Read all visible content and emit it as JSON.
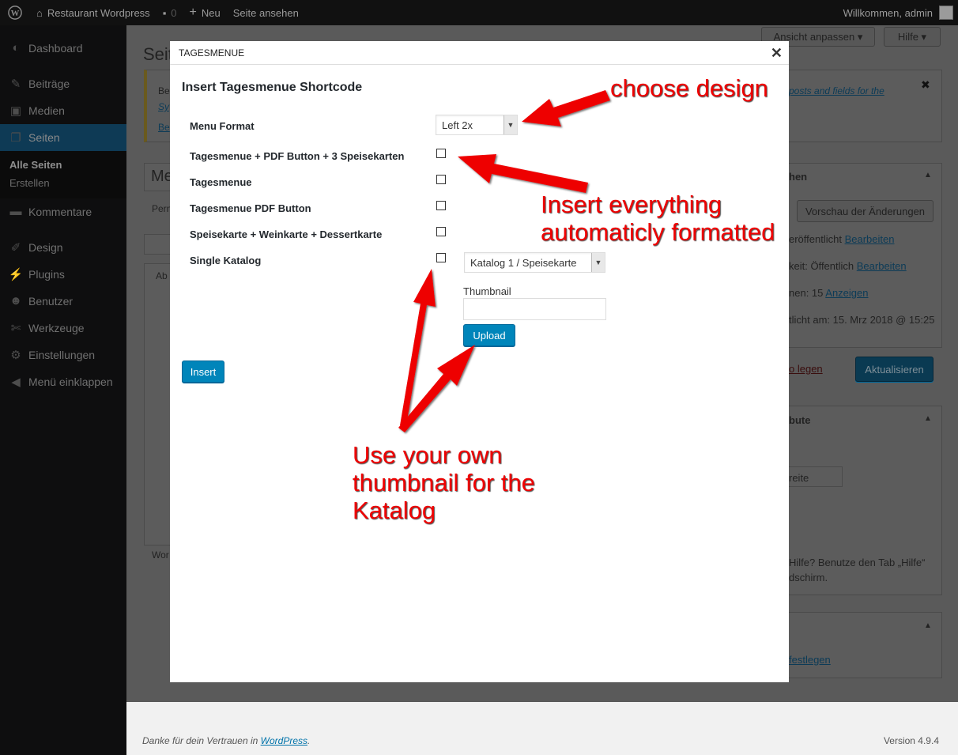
{
  "adminbar": {
    "site_name": "Restaurant Wordpress",
    "comments_count": "0",
    "new_label": "Neu",
    "view_page": "Seite ansehen",
    "welcome": "Willkommen, admin"
  },
  "sidebar": {
    "items": [
      {
        "label": "Dashboard",
        "icon": "dashboard-icon"
      },
      {
        "label": "Beiträge",
        "icon": "pin-icon"
      },
      {
        "label": "Medien",
        "icon": "media-icon"
      },
      {
        "label": "Seiten",
        "icon": "pages-icon"
      },
      {
        "label": "Kommentare",
        "icon": "comment-icon"
      },
      {
        "label": "Design",
        "icon": "brush-icon"
      },
      {
        "label": "Plugins",
        "icon": "plugin-icon"
      },
      {
        "label": "Benutzer",
        "icon": "user-icon"
      },
      {
        "label": "Werkzeuge",
        "icon": "wrench-icon"
      },
      {
        "label": "Einstellungen",
        "icon": "settings-icon"
      },
      {
        "label": "Menü einklappen",
        "icon": "collapse-icon"
      }
    ],
    "submenu": [
      "Alle Seiten",
      "Erstellen"
    ]
  },
  "background": {
    "screen_options": "Ansicht anpassen",
    "help": "Hilfe",
    "page_heading": "Seit",
    "notice_b1": "Be",
    "notice_b2": "Sy",
    "notice_b3": "Be",
    "notice_link": "posts and fields for the",
    "title_field": "Me",
    "permalink": "Pern",
    "tab_fragment": "Ab",
    "wordcount": "Wor",
    "publish_box": {
      "heading": "hen",
      "preview": "Vorschau der Änderungen",
      "status": "eröffentlicht",
      "status_edit": "Bearbeiten",
      "visibility": "keit: Öffentlich",
      "visibility_edit": "Bearbeiten",
      "revisions": "nen: 15",
      "revisions_link": "Anzeigen",
      "published": "tlicht am: 15. Mrz 2018 @ 15:25",
      "trash": "o legen",
      "update": "Aktualisieren"
    },
    "attributes_box": {
      "heading": "bute",
      "template": "reite"
    },
    "help_text_1": "Hilfe? Benutze den Tab „Hilfe“",
    "help_text_2": "dschirm.",
    "featured_link": "festlegen"
  },
  "modal": {
    "header": "TAGESMENUE",
    "title": "Insert Tagesmenue Shortcode",
    "menu_format_label": "Menu Format",
    "menu_format_value": "Left 2x",
    "options": [
      "Tagesmenue + PDF Button + 3 Speisekarten",
      "Tagesmenue",
      "Tagesmenue PDF Button",
      "Speisekarte + Weinkarte + Dessertkarte",
      "Single Katalog"
    ],
    "katalog_value": "Katalog 1 / Speisekarte",
    "thumbnail_label": "Thumbnail",
    "upload_label": "Upload",
    "insert_label": "Insert"
  },
  "annotations": {
    "choose_design": "choose design",
    "insert_everything_1": "Insert everything",
    "insert_everything_2": "automaticly formatted",
    "own_thumb_1": "Use your own",
    "own_thumb_2": "thumbnail for the",
    "own_thumb_3": "Katalog",
    "color": "#ee0000"
  },
  "footer": {
    "thanks_prefix": "Danke für dein Vertrauen in ",
    "thanks_link": "WordPress",
    "thanks_suffix": ".",
    "version": "Version 4.9.4"
  }
}
